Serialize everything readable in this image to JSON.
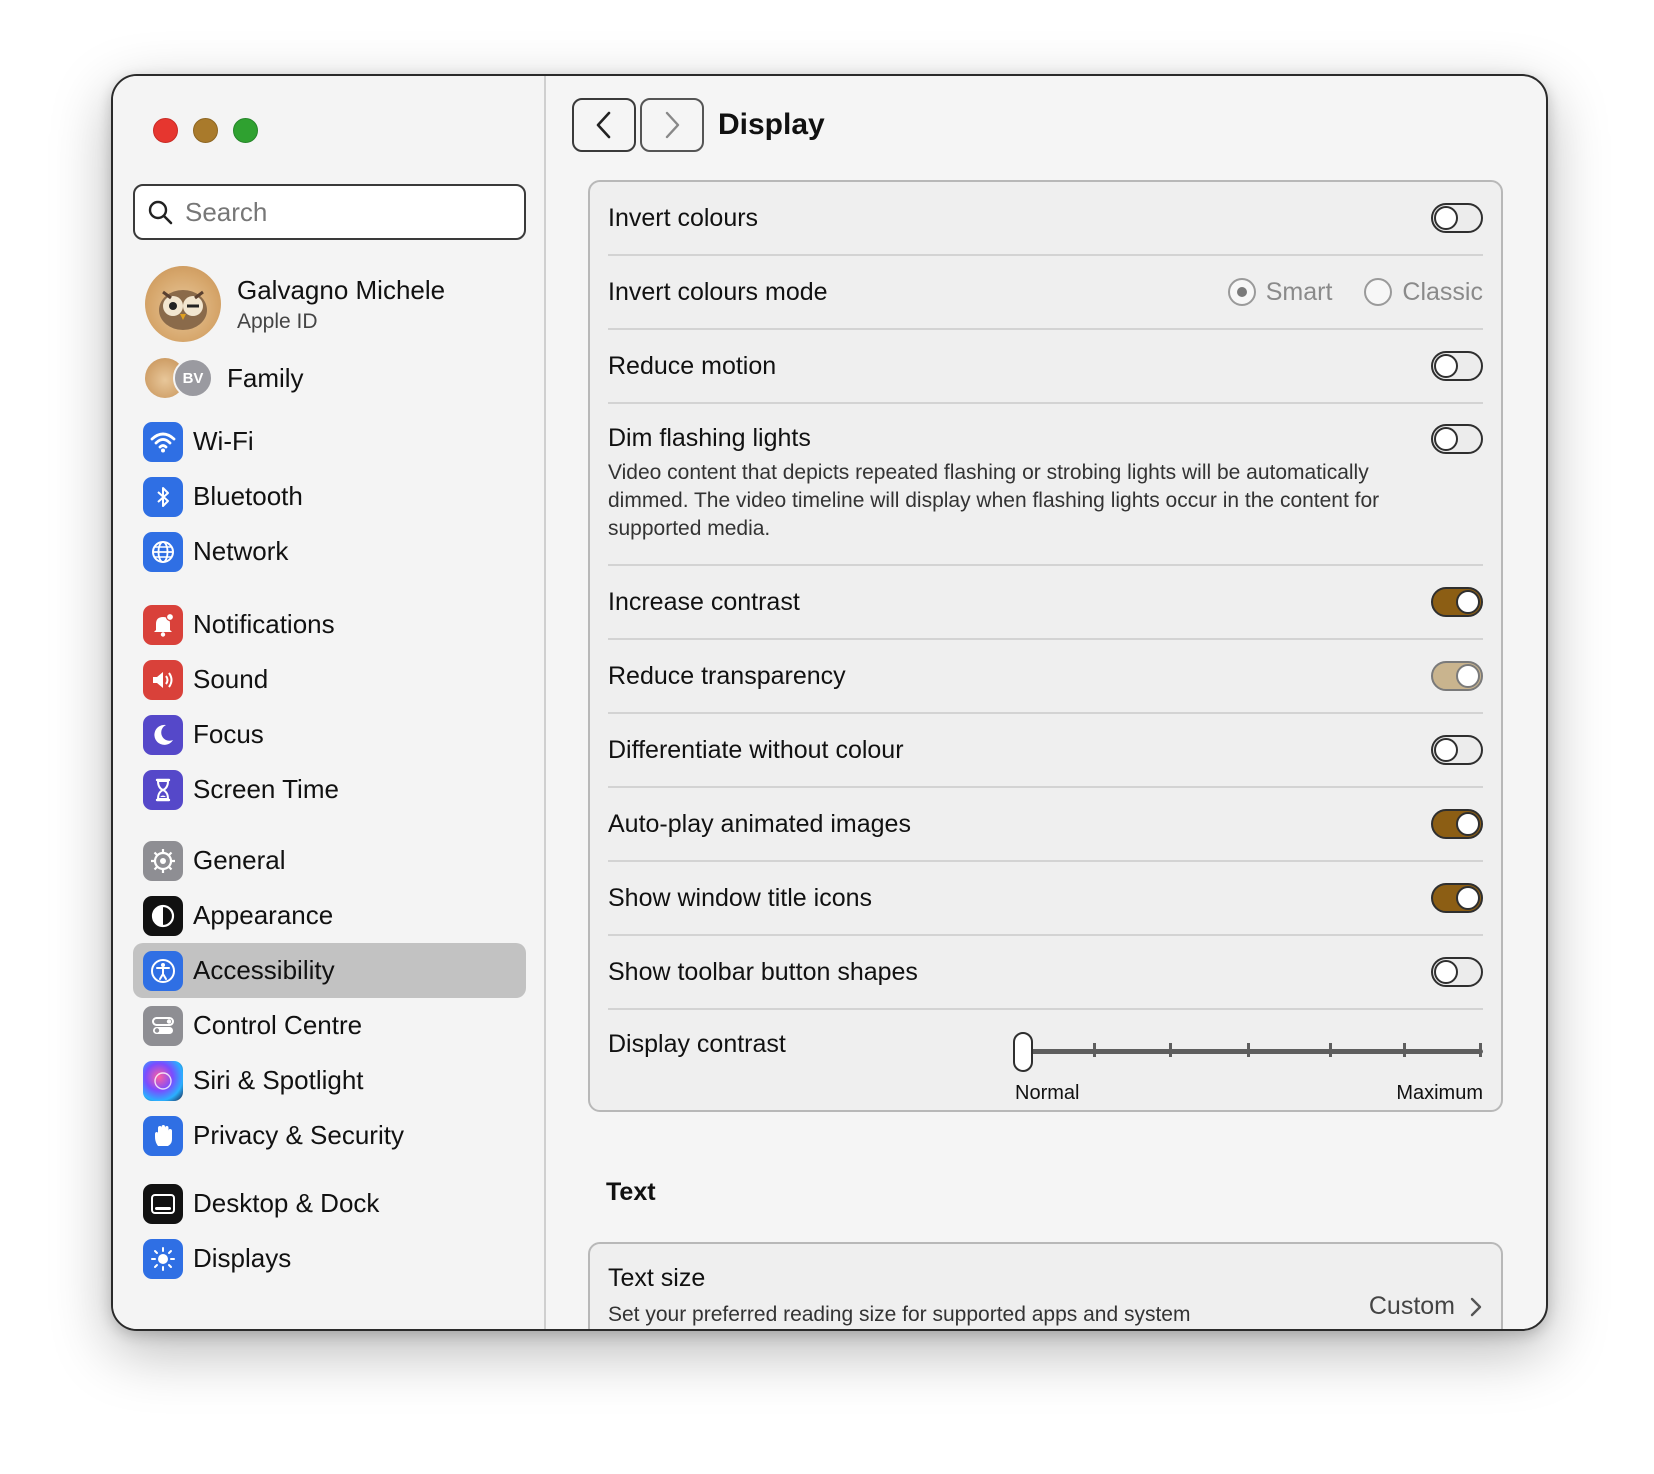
{
  "window": {
    "title": "Display"
  },
  "search": {
    "placeholder": "Search"
  },
  "profile": {
    "name": "Galvagno Michele",
    "subtitle": "Apple ID"
  },
  "family": {
    "label": "Family",
    "second_initials": "BV"
  },
  "sidebar": {
    "group1": [
      {
        "label": "Wi-Fi",
        "icon": "wifi-icon",
        "color": "#2f6fe4"
      },
      {
        "label": "Bluetooth",
        "icon": "bluetooth-icon",
        "color": "#2f6fe4"
      },
      {
        "label": "Network",
        "icon": "globe-icon",
        "color": "#2f6fe4"
      }
    ],
    "group2": [
      {
        "label": "Notifications",
        "icon": "bell-icon",
        "color": "#d9413a"
      },
      {
        "label": "Sound",
        "icon": "speaker-icon",
        "color": "#d9413a"
      },
      {
        "label": "Focus",
        "icon": "moon-icon",
        "color": "#5548c9"
      },
      {
        "label": "Screen Time",
        "icon": "hourglass-icon",
        "color": "#5548c9"
      }
    ],
    "group3": [
      {
        "label": "General",
        "icon": "gear-icon",
        "color": "#8e8e93"
      },
      {
        "label": "Appearance",
        "icon": "appearance-icon",
        "color": "#111111"
      },
      {
        "label": "Accessibility",
        "icon": "accessibility-icon",
        "color": "#2f6fe4",
        "selected": true
      },
      {
        "label": "Control Centre",
        "icon": "switches-icon",
        "color": "#8e8e93"
      },
      {
        "label": "Siri & Spotlight",
        "icon": "siri-icon",
        "color": "#3a3a6a"
      },
      {
        "label": "Privacy & Security",
        "icon": "hand-icon",
        "color": "#2f6fe4"
      }
    ],
    "group4": [
      {
        "label": "Desktop & Dock",
        "icon": "dock-icon",
        "color": "#111111"
      },
      {
        "label": "Displays",
        "icon": "sun-icon",
        "color": "#2f6fe4"
      }
    ]
  },
  "settings": {
    "invert_colours": {
      "label": "Invert colours",
      "on": false
    },
    "invert_mode": {
      "label": "Invert colours mode",
      "options": [
        "Smart",
        "Classic"
      ],
      "selected": "Smart"
    },
    "reduce_motion": {
      "label": "Reduce motion",
      "on": false
    },
    "dim_flashing": {
      "label": "Dim flashing lights",
      "description": "Video content that depicts repeated flashing or strobing lights will be automatically dimmed. The video timeline will display when flashing lights occur in the content for supported media.",
      "on": false
    },
    "increase_contrast": {
      "label": "Increase contrast",
      "on": true
    },
    "reduce_transparency": {
      "label": "Reduce transparency",
      "on": true,
      "disabled": true
    },
    "differentiate": {
      "label": "Differentiate without colour",
      "on": false
    },
    "autoplay": {
      "label": "Auto-play animated images",
      "on": true
    },
    "title_icons": {
      "label": "Show window title icons",
      "on": true
    },
    "toolbar_shapes": {
      "label": "Show toolbar button shapes",
      "on": false
    },
    "display_contrast": {
      "label": "Display contrast",
      "min_label": "Normal",
      "max_label": "Maximum",
      "value": 0
    }
  },
  "text_section": {
    "title": "Text",
    "text_size": {
      "label": "Text size",
      "description": "Set your preferred reading size for supported apps and system features.",
      "value": "Custom"
    }
  },
  "colors": {
    "accent": "#8c5e14",
    "selected_bg": "#c2c2c2"
  }
}
